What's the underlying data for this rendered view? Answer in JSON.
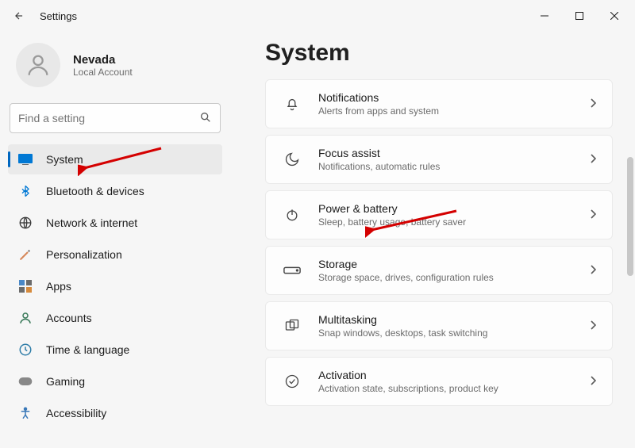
{
  "window": {
    "title": "Settings"
  },
  "profile": {
    "name": "Nevada",
    "type": "Local Account"
  },
  "search": {
    "placeholder": "Find a setting"
  },
  "nav": [
    {
      "key": "system",
      "label": "System",
      "selected": true,
      "iconColor": "#0078d4",
      "iconBg": "#0078d4"
    },
    {
      "key": "bluetooth",
      "label": "Bluetooth & devices"
    },
    {
      "key": "network",
      "label": "Network & internet"
    },
    {
      "key": "personalization",
      "label": "Personalization"
    },
    {
      "key": "apps",
      "label": "Apps"
    },
    {
      "key": "accounts",
      "label": "Accounts"
    },
    {
      "key": "time",
      "label": "Time & language"
    },
    {
      "key": "gaming",
      "label": "Gaming"
    },
    {
      "key": "accessibility",
      "label": "Accessibility"
    }
  ],
  "page": {
    "title": "System",
    "items": [
      {
        "key": "notifications",
        "title": "Notifications",
        "subtitle": "Alerts from apps and system"
      },
      {
        "key": "focus",
        "title": "Focus assist",
        "subtitle": "Notifications, automatic rules"
      },
      {
        "key": "power",
        "title": "Power & battery",
        "subtitle": "Sleep, battery usage, battery saver"
      },
      {
        "key": "storage",
        "title": "Storage",
        "subtitle": "Storage space, drives, configuration rules"
      },
      {
        "key": "multitasking",
        "title": "Multitasking",
        "subtitle": "Snap windows, desktops, task switching"
      },
      {
        "key": "activation",
        "title": "Activation",
        "subtitle": "Activation state, subscriptions, product key"
      }
    ]
  }
}
